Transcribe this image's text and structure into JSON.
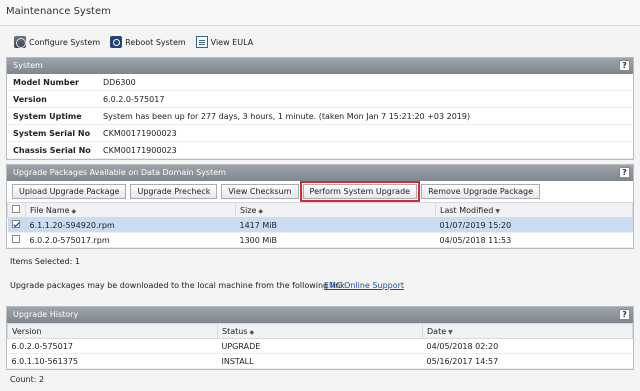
{
  "window": {
    "title": "Maintenance System"
  },
  "toolbar": {
    "configure": "Configure System",
    "reboot": "Reboot System",
    "eula": "View EULA"
  },
  "system": {
    "header": "System",
    "help": "?",
    "rows": [
      {
        "label": "Model Number",
        "value": "DD6300"
      },
      {
        "label": "Version",
        "value": "6.0.2.0-575017"
      },
      {
        "label": "System Uptime",
        "value": "System has been up for 277 days, 3 hours, 1 minute. (taken Mon Jan 7 15:21:20 +03 2019)"
      },
      {
        "label": "System Serial No",
        "value": "CKM00171900023"
      },
      {
        "label": "Chassis Serial No",
        "value": "CKM00171900023"
      }
    ]
  },
  "upgrade": {
    "header": "Upgrade Packages Available on Data Domain System",
    "help": "?",
    "buttons": {
      "upload": "Upload Upgrade Package",
      "precheck": "Upgrade Precheck",
      "checksum": "View Checksum",
      "perform": "Perform System Upgrade",
      "remove": "Remove Upgrade Package"
    },
    "columns": {
      "file": "File Name",
      "size": "Size",
      "modified": "Last Modified"
    },
    "rows": [
      {
        "file": "6.1.1.20-594920.rpm",
        "size": "1417 MiB",
        "modified": "01/07/2019 15:20"
      },
      {
        "file": "6.0.2.0-575017.rpm",
        "size": "1300 MiB",
        "modified": "04/05/2018 11:53"
      }
    ],
    "selected": "Items Selected: 1",
    "note": "Upgrade packages may be downloaded to the local machine from the following link.",
    "link": "EMC Online Support"
  },
  "history": {
    "header": "Upgrade History",
    "help": "?",
    "columns": {
      "version": "Version",
      "status": "Status",
      "date": "Date"
    },
    "rows": [
      {
        "version": "6.0.2.0-575017",
        "status": "UPGRADE",
        "date": "04/05/2018 02:20"
      },
      {
        "version": "6.0.1.10-561375",
        "status": "INSTALL",
        "date": "05/16/2017 14:57"
      }
    ],
    "count": "Count: 2"
  }
}
